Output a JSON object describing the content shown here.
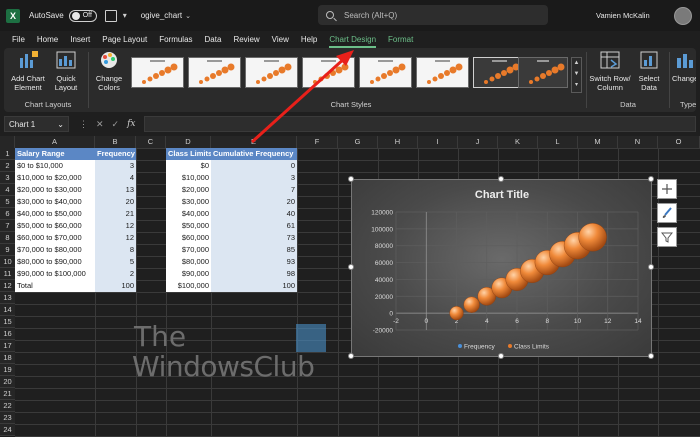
{
  "titlebar": {
    "autosave_label": "AutoSave",
    "autosave_state": "Off",
    "filename": "ogive_chart",
    "search_placeholder": "Search (Alt+Q)",
    "user": "Vamien McKalin"
  },
  "menu": [
    "File",
    "Home",
    "Insert",
    "Page Layout",
    "Formulas",
    "Data",
    "Review",
    "View",
    "Help",
    "Chart Design",
    "Format"
  ],
  "ribbon": {
    "add_chart_element": "Add Chart Element",
    "quick_layout": "Quick Layout",
    "change_colors": "Change Colors",
    "group_chart_layouts": "Chart Layouts",
    "group_chart_styles": "Chart Styles",
    "switch_row_column": "Switch Row/ Column",
    "select_data": "Select Data",
    "group_data": "Data",
    "change_chart_type": "Change Chart Type",
    "group_type": "Type"
  },
  "formula": {
    "name_box": "Chart 1",
    "fx": "fx"
  },
  "columns": [
    "A",
    "B",
    "C",
    "D",
    "E",
    "F",
    "G",
    "H",
    "I",
    "J",
    "K",
    "L",
    "M",
    "N",
    "O"
  ],
  "rows": [
    "1",
    "2",
    "3",
    "4",
    "5",
    "6",
    "7",
    "8",
    "9",
    "10",
    "11",
    "12",
    "13",
    "14",
    "15",
    "16",
    "17",
    "18",
    "19",
    "20",
    "21",
    "22",
    "23",
    "24"
  ],
  "table": {
    "headers": [
      "Salary Range",
      "Frequency",
      "Class Limits",
      "Cumulative Frequency"
    ],
    "rows": [
      [
        "$0 to $10,000",
        "3",
        "$0",
        "0"
      ],
      [
        "$10,000 to $20,000",
        "4",
        "$10,000",
        "3"
      ],
      [
        "$20,000 to $30,000",
        "13",
        "$20,000",
        "7"
      ],
      [
        "$30,000 to $40,000",
        "20",
        "$30,000",
        "20"
      ],
      [
        "$40,000 to $50,000",
        "21",
        "$40,000",
        "40"
      ],
      [
        "$50,000 to $60,000",
        "12",
        "$50,000",
        "61"
      ],
      [
        "$60,000 to $70,000",
        "12",
        "$60,000",
        "73"
      ],
      [
        "$70,000 to $80,000",
        "8",
        "$70,000",
        "85"
      ],
      [
        "$80,000 to $90,000",
        "5",
        "$80,000",
        "93"
      ],
      [
        "$90,000 to $100,000",
        "2",
        "$90,000",
        "98"
      ]
    ],
    "total": [
      "Total",
      "100",
      "$100,000",
      "100"
    ]
  },
  "chart_data": {
    "type": "scatter",
    "title": "Chart Title",
    "x": [
      2,
      3,
      4,
      5,
      6,
      7,
      8,
      9,
      10,
      11
    ],
    "series": [
      {
        "name": "Frequency",
        "values": [
          3,
          4,
          13,
          20,
          21,
          12,
          12,
          8,
          5,
          2
        ]
      },
      {
        "name": "Class Limits",
        "values": [
          0,
          10000,
          20000,
          30000,
          40000,
          50000,
          60000,
          70000,
          80000,
          90000
        ]
      }
    ],
    "bubble_size_relative": [
      0.35,
      0.45,
      0.55,
      0.65,
      0.75,
      0.8,
      0.85,
      0.9,
      0.95,
      1.0
    ],
    "xlim": [
      -2,
      14
    ],
    "ylim": [
      -20000,
      120000
    ],
    "xticks": [
      "-2",
      "0",
      "2",
      "4",
      "6",
      "8",
      "10",
      "12",
      "14"
    ],
    "yticks": [
      "-20000",
      "0",
      "20000",
      "40000",
      "60000",
      "80000",
      "100000",
      "120000"
    ],
    "grid": true,
    "legend": "bottom",
    "colors": {
      "frequency": "#4a90d9",
      "class_limits": "#e87a2a"
    }
  },
  "watermark": {
    "line1": "The",
    "line2": "WindowsClub"
  }
}
